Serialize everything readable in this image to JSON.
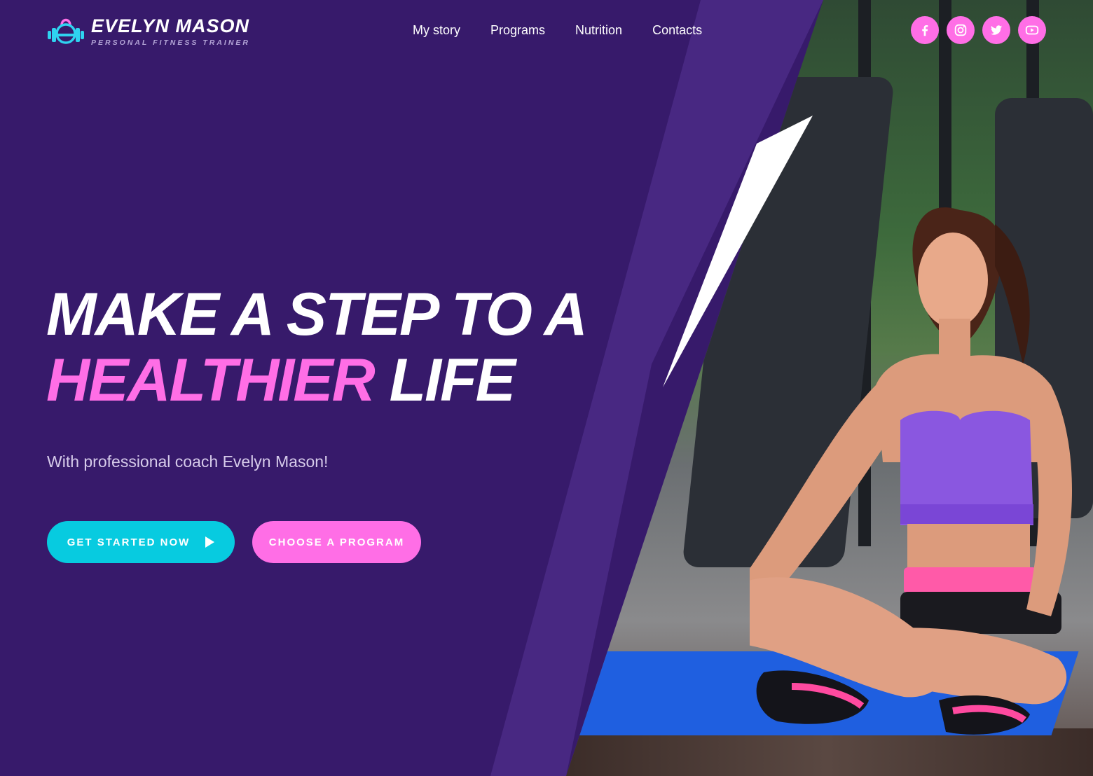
{
  "brand": {
    "name": "EVELYN MASON",
    "tagline": "PERSONAL FITNESS TRAINER",
    "logo_icon": "dumbbell-kettlebell-icon"
  },
  "nav": {
    "items": [
      {
        "label": "My story"
      },
      {
        "label": "Programs"
      },
      {
        "label": "Nutrition"
      },
      {
        "label": "Contacts"
      }
    ]
  },
  "social": {
    "icons": [
      "facebook-icon",
      "instagram-icon",
      "twitter-icon",
      "youtube-icon"
    ]
  },
  "hero": {
    "line1": "MAKE A STEP TO A",
    "accent_word": "HEALTHIER",
    "line2_rest": "LIFE",
    "subtitle": "With professional coach Evelyn Mason!",
    "primary_button": "GET STARTED NOW",
    "secondary_button": "CHOOSE A PROGRAM"
  },
  "colors": {
    "background": "#371a6b",
    "accent_pink": "#ff6ee6",
    "accent_cyan": "#07cbe0",
    "subtitle": "#d6cbea"
  }
}
